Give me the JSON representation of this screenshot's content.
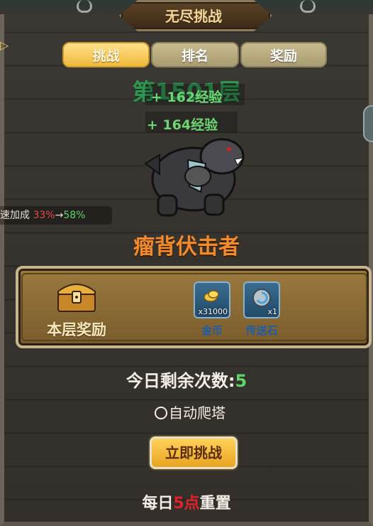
{
  "title": "无尽挑战",
  "tabs": [
    {
      "label": "挑战",
      "active": true
    },
    {
      "label": "排名",
      "active": false
    },
    {
      "label": "奖励",
      "active": false
    }
  ],
  "floor": {
    "prefix": "第",
    "number": "1501",
    "suffix": "层"
  },
  "exp_gains": [
    "+ 162经验",
    "+ 164经验"
  ],
  "speed_bonus": {
    "label": "攻速加成",
    "old": "33%",
    "arrow": "→",
    "new": "58%"
  },
  "monster_name": "瘤背伏击者",
  "floor_reward": {
    "label": "本层奖励",
    "items": [
      {
        "name": "金币",
        "qty": "x31000",
        "icon": "gold-coin-icon"
      },
      {
        "name": "传送石",
        "qty": "x1",
        "icon": "teleport-stone-icon"
      }
    ]
  },
  "remaining": {
    "label": "今日剩余次数:",
    "value": "5"
  },
  "auto_climb": {
    "label": "自动爬塔",
    "checked": false
  },
  "challenge_button": "立即挑战",
  "reset": {
    "prefix": "每日",
    "hour": "5点",
    "suffix": "重置"
  },
  "colors": {
    "accent": "#f0b93a",
    "exp_green": "#6cd674",
    "monster_orange": "#f08a2a",
    "red": "#e4202a"
  }
}
